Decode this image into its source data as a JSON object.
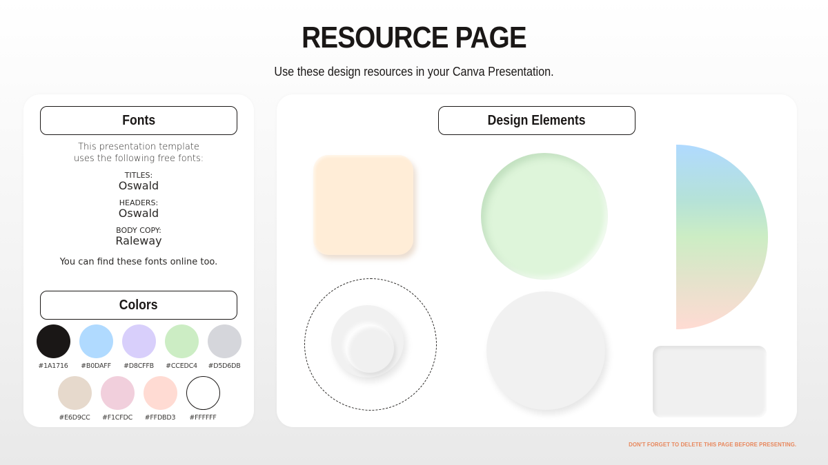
{
  "header": {
    "title": "RESOURCE PAGE",
    "subtitle": "Use these design resources in your Canva Presentation."
  },
  "fonts_panel": {
    "heading": "Fonts",
    "intro_line1": "This presentation template",
    "intro_line2": "uses the following free fonts:",
    "fonts": [
      {
        "label": "TITLES:",
        "name": "Oswald"
      },
      {
        "label": "HEADERS:",
        "name": "Oswald"
      },
      {
        "label": "BODY COPY:",
        "name": "Raleway"
      }
    ],
    "outro": "You can find these fonts online too."
  },
  "colors_panel": {
    "heading": "Colors",
    "swatches": [
      {
        "hex": "#1A1716",
        "color": "#1A1716"
      },
      {
        "hex": "#B0DAFF",
        "color": "#B0DAFF"
      },
      {
        "hex": "#D8CFFB",
        "color": "#D8CFFB"
      },
      {
        "hex": "#CCEDC4",
        "color": "#CCEDC4"
      },
      {
        "hex": "#D5D6DB",
        "color": "#D5D6DB"
      },
      {
        "hex": "#E6D9CC",
        "color": "#E6D9CC"
      },
      {
        "hex": "#F1CFDC",
        "color": "#F1CFDC"
      },
      {
        "hex": "#FFDBD3",
        "color": "#FFDBD3"
      },
      {
        "hex": "#FFFFFF",
        "color": "#FFFFFF"
      }
    ]
  },
  "design_panel": {
    "heading": "Design Elements"
  },
  "footer": {
    "note": "DON'T FORGET TO DELETE THIS PAGE BEFORE PRESENTING."
  }
}
